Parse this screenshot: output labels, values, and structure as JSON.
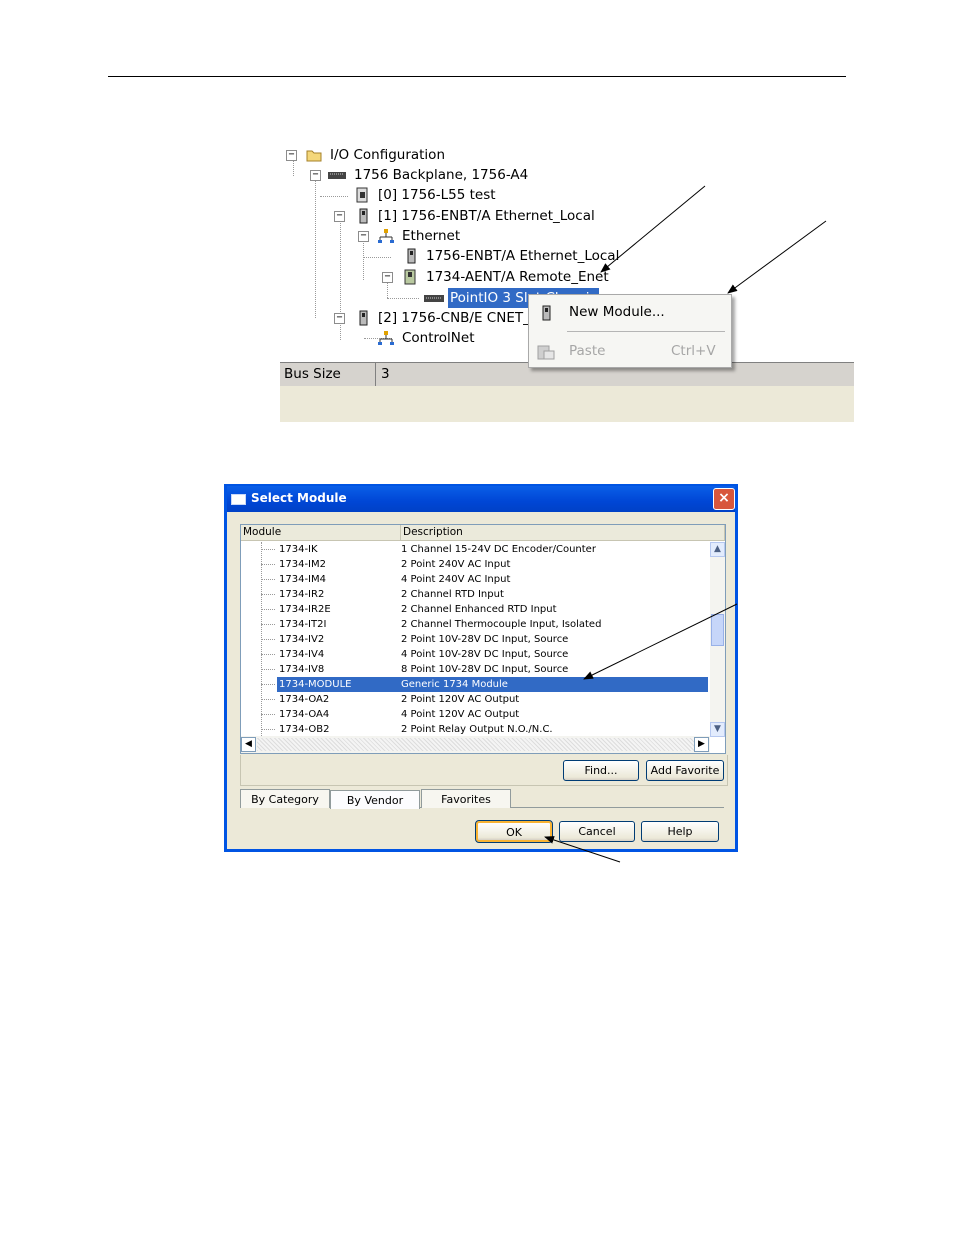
{
  "tree": {
    "nodes": [
      {
        "label": "I/O Configuration",
        "icon": "folder-icon",
        "toggle": "−"
      },
      {
        "label": "1756 Backplane, 1756-A4",
        "icon": "backplane-icon",
        "toggle": "−"
      },
      {
        "label": "[0] 1756-L55 test",
        "icon": "controller-icon",
        "toggle": ""
      },
      {
        "label": "[1] 1756-ENBT/A Ethernet_Local",
        "icon": "module-icon",
        "toggle": "−"
      },
      {
        "label": "Ethernet",
        "icon": "network-icon",
        "toggle": "−"
      },
      {
        "label": "1756-ENBT/A Ethernet_Local",
        "icon": "module-icon",
        "toggle": ""
      },
      {
        "label": "1734-AENT/A Remote_Enet",
        "icon": "adapter-icon",
        "toggle": "−"
      },
      {
        "label": "PointIO 3 Slot Chassis",
        "icon": "chassis-icon",
        "toggle": ""
      },
      {
        "label": "[2] 1756-CNB/E CNET_Local",
        "icon": "module-icon",
        "toggle": "−"
      },
      {
        "label": "ControlNet",
        "icon": "network-icon",
        "toggle": ""
      }
    ],
    "property": {
      "name": "Bus Size",
      "value": "3"
    }
  },
  "context_menu": {
    "items": [
      {
        "label": "New Module...",
        "shortcut": "",
        "icon": "module-icon",
        "enabled": true
      },
      {
        "label": "Paste",
        "shortcut": "Ctrl+V",
        "icon": "paste-icon",
        "enabled": false
      }
    ]
  },
  "dialog": {
    "title": "Select Module",
    "close_label": "×",
    "columns": [
      "Module",
      "Description"
    ],
    "rows": [
      {
        "module": "1734-IK",
        "description": "1 Channel 15-24V DC Encoder/Counter"
      },
      {
        "module": "1734-IM2",
        "description": "2 Point 240V AC Input"
      },
      {
        "module": "1734-IM4",
        "description": "4 Point 240V AC Input"
      },
      {
        "module": "1734-IR2",
        "description": "2 Channel RTD Input"
      },
      {
        "module": "1734-IR2E",
        "description": "2 Channel Enhanced RTD Input"
      },
      {
        "module": "1734-IT2I",
        "description": "2 Channel Thermocouple Input, Isolated"
      },
      {
        "module": "1734-IV2",
        "description": "2 Point 10V-28V DC Input, Source"
      },
      {
        "module": "1734-IV4",
        "description": "4 Point 10V-28V DC Input, Source"
      },
      {
        "module": "1734-IV8",
        "description": "8 Point 10V-28V DC Input, Source"
      },
      {
        "module": "1734-MODULE",
        "description": "Generic 1734 Module",
        "selected": true
      },
      {
        "module": "1734-OA2",
        "description": "2 Point 120V AC Output"
      },
      {
        "module": "1734-OA4",
        "description": "4 Point 120V AC Output"
      },
      {
        "module": "1734-OB2",
        "description": "2 Point Relay Output N.O./N.C."
      }
    ],
    "find_label": "Find...",
    "add_favorite_label": "Add Favorite",
    "tabs": [
      {
        "label": "By Category",
        "active": false
      },
      {
        "label": "By Vendor",
        "active": true
      },
      {
        "label": "Favorites",
        "active": false
      }
    ],
    "ok_label": "OK",
    "cancel_label": "Cancel",
    "help_label": "Help"
  },
  "colors": {
    "selection": "#316ac5",
    "dialog_frame": "#0054e3",
    "dialog_face": "#ece9d8"
  }
}
